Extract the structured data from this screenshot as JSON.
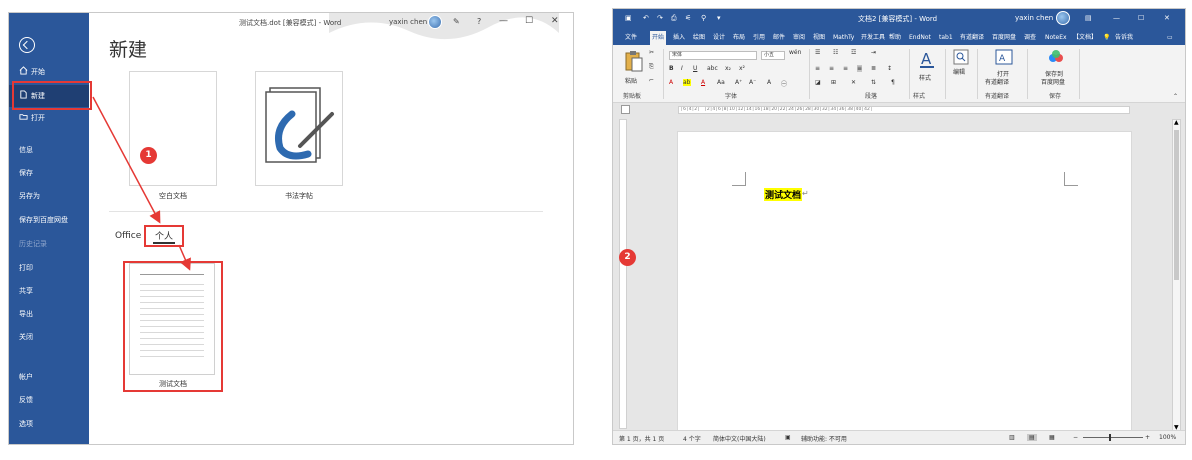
{
  "left_window": {
    "title": "测试文档.dot [兼容模式] - Word",
    "user": "yaxin chen",
    "heading": "新建",
    "sidebar": {
      "items": [
        {
          "label": "开始"
        },
        {
          "label": "新建"
        },
        {
          "label": "打开"
        },
        {
          "label": "信息"
        },
        {
          "label": "保存"
        },
        {
          "label": "另存为"
        },
        {
          "label": "保存到百度网盘"
        },
        {
          "label": "历史记录"
        },
        {
          "label": "打印"
        },
        {
          "label": "共享"
        },
        {
          "label": "导出"
        },
        {
          "label": "关闭"
        },
        {
          "label": "帐户"
        },
        {
          "label": "反馈"
        },
        {
          "label": "选项"
        }
      ]
    },
    "templates": [
      {
        "label": "空白文档"
      },
      {
        "label": "书法字帖"
      }
    ],
    "tabs": {
      "office": "Office",
      "personal": "个人"
    },
    "personal_template": {
      "label": "测试文档"
    },
    "badge": "1"
  },
  "right_window": {
    "title": "文档2 [兼容模式] - Word",
    "user": "yaxin chen",
    "tabs": [
      "文件",
      "开始",
      "插入",
      "绘图",
      "设计",
      "布局",
      "引用",
      "邮件",
      "审阅",
      "视图",
      "MathTy",
      "开发工具",
      "帮助",
      "EndNot",
      "tab1",
      "有道翻译",
      "百度网盘",
      "调查",
      "NoteEx",
      "【文档】",
      "告诉我"
    ],
    "ribbon": {
      "font_name": "宋体",
      "font_size": "小五",
      "paste_label": "粘贴",
      "styles_label": "样式",
      "edit_label": "编辑",
      "open_label": "打开",
      "translate_label": "有道翻译",
      "save_to_label": "保存到",
      "baidu_label": "百度网盘",
      "groups": [
        "剪贴板",
        "字体",
        "段落",
        "样式",
        "有道翻译",
        "保存"
      ]
    },
    "document_text": "测试文档",
    "badge": "2",
    "status": {
      "page": "第 1 页，共 1 页",
      "words": "4 个字",
      "lang": "简体中文(中国大陆)",
      "accessibility": "辅助功能: 不可用",
      "zoom": "100%"
    }
  },
  "colors": {
    "word_blue": "#2b579a",
    "annotation_red": "#e53935",
    "highlight": "#ffff00"
  }
}
